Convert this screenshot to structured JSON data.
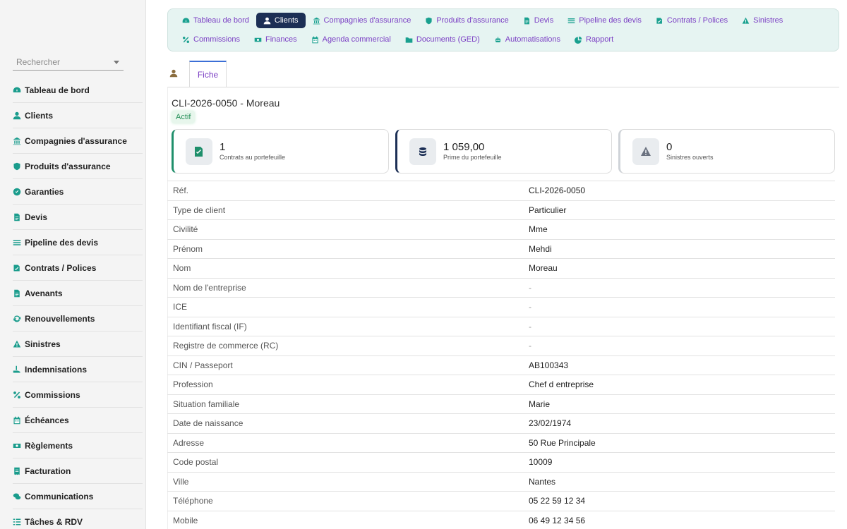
{
  "sidebar": {
    "search_placeholder": "Rechercher",
    "items": [
      {
        "label": "Tableau de bord",
        "icon": "dashboard-icon"
      },
      {
        "label": "Clients",
        "icon": "user-icon"
      },
      {
        "label": "Compagnies d'assurance",
        "icon": "bank-icon"
      },
      {
        "label": "Produits d'assurance",
        "icon": "shield-icon"
      },
      {
        "label": "Garanties",
        "icon": "check-circle-icon"
      },
      {
        "label": "Devis",
        "icon": "document-icon"
      },
      {
        "label": "Pipeline des devis",
        "icon": "list-icon"
      },
      {
        "label": "Contrats / Polices",
        "icon": "signature-icon"
      },
      {
        "label": "Avenants",
        "icon": "document-icon"
      },
      {
        "label": "Renouvellements",
        "icon": "refresh-icon"
      },
      {
        "label": "Sinistres",
        "icon": "warning-icon"
      },
      {
        "label": "Indemnisations",
        "icon": "hand-icon"
      },
      {
        "label": "Commissions",
        "icon": "percent-icon"
      },
      {
        "label": "Échéances",
        "icon": "calendar-icon"
      },
      {
        "label": "Règlements",
        "icon": "money-icon"
      },
      {
        "label": "Facturation",
        "icon": "invoice-icon"
      },
      {
        "label": "Communications",
        "icon": "chat-icon"
      },
      {
        "label": "Tâches & RDV",
        "icon": "tasks-icon"
      }
    ]
  },
  "topnav": {
    "row1": [
      {
        "label": "Tableau de bord",
        "icon": "dashboard-icon",
        "active": false
      },
      {
        "label": "Clients",
        "icon": "user-icon",
        "active": true
      },
      {
        "label": "Compagnies d'assurance",
        "icon": "bank-icon",
        "active": false
      },
      {
        "label": "Produits d'assurance",
        "icon": "shield-icon",
        "active": false
      },
      {
        "label": "Devis",
        "icon": "document-icon",
        "active": false
      },
      {
        "label": "Pipeline des devis",
        "icon": "list-icon",
        "active": false
      },
      {
        "label": "Contrats / Polices",
        "icon": "signature-icon",
        "active": false
      },
      {
        "label": "Sinistres",
        "icon": "warning-icon",
        "active": false
      }
    ],
    "row2": [
      {
        "label": "Commissions",
        "icon": "percent-icon",
        "active": false
      },
      {
        "label": "Finances",
        "icon": "money-icon",
        "active": false
      },
      {
        "label": "Agenda commercial",
        "icon": "calendar-icon",
        "active": false
      },
      {
        "label": "Documents (GED)",
        "icon": "folder-icon",
        "active": false
      },
      {
        "label": "Automatisations",
        "icon": "robot-icon",
        "active": false
      },
      {
        "label": "Rapport",
        "icon": "pie-chart-icon",
        "active": false
      }
    ]
  },
  "tabs": {
    "fiche_label": "Fiche"
  },
  "client": {
    "title": "CLI-2026-0050 - Moreau",
    "status": "Actif"
  },
  "stats": {
    "contrats": {
      "value": "1",
      "label": "Contrats au portefeuille"
    },
    "prime": {
      "value": "1 059,00",
      "label": "Prime du portefeuille"
    },
    "sinistres": {
      "value": "0",
      "label": "Sinistres ouverts"
    }
  },
  "details": [
    {
      "label": "Réf.",
      "value": "CLI-2026-0050"
    },
    {
      "label": "Type de client",
      "value": "Particulier"
    },
    {
      "label": "Civilité",
      "value": "Mme"
    },
    {
      "label": "Prénom",
      "value": "Mehdi"
    },
    {
      "label": "Nom",
      "value": "Moreau"
    },
    {
      "label": "Nom de l'entreprise",
      "value": "-"
    },
    {
      "label": "ICE",
      "value": "-"
    },
    {
      "label": "Identifiant fiscal (IF)",
      "value": "-"
    },
    {
      "label": "Registre de commerce (RC)",
      "value": "-"
    },
    {
      "label": "CIN / Passeport",
      "value": "AB100343"
    },
    {
      "label": "Profession",
      "value": "Chef d entreprise"
    },
    {
      "label": "Situation familiale",
      "value": "Marie"
    },
    {
      "label": "Date de naissance",
      "value": "23/02/1974"
    },
    {
      "label": "Adresse",
      "value": "50 Rue Principale"
    },
    {
      "label": "Code postal",
      "value": "10009"
    },
    {
      "label": "Ville",
      "value": "Nantes"
    },
    {
      "label": "Téléphone",
      "value": "05 22 59 12 34"
    },
    {
      "label": "Mobile",
      "value": "06 49 12 34 56"
    }
  ],
  "colors": {
    "accent_teal": "#1a9c8c",
    "nav_text": "#7b3fc4",
    "active_nav": "#1c2f55",
    "status_green": "#27915a"
  }
}
